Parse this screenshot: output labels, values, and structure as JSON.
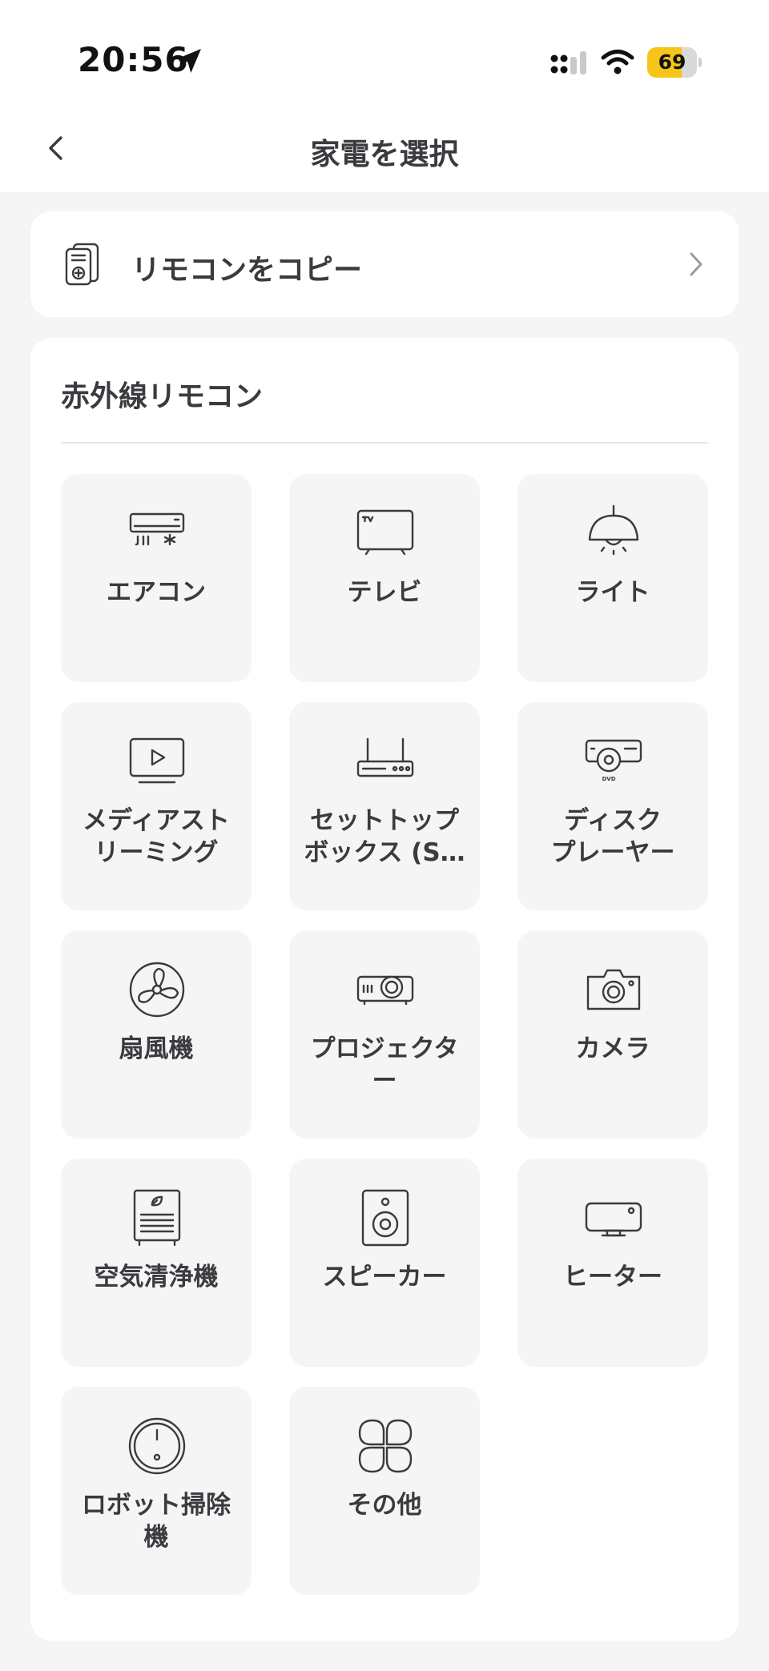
{
  "status_bar": {
    "time": "20:56",
    "battery": "69",
    "battery_level": 0.69
  },
  "nav": {
    "title": "家電を選択",
    "back_icon": "chevron-left-icon"
  },
  "copy_remote": {
    "label": "リモコンをコピー",
    "icon": "remote-copy-icon",
    "chevron_icon": "chevron-right-icon"
  },
  "ir_section": {
    "title": "赤外線リモコン",
    "devices": [
      {
        "label": "エアコン",
        "icon": "air-conditioner-icon"
      },
      {
        "label": "テレビ",
        "icon": "tv-icon"
      },
      {
        "label": "ライト",
        "icon": "light-icon"
      },
      {
        "label": "メディアスト\nリーミング",
        "icon": "media-streaming-icon"
      },
      {
        "label": "セットトップ\nボックス (S…",
        "icon": "set-top-box-icon"
      },
      {
        "label": "ディスク\nプレーヤー",
        "icon": "disc-player-icon"
      },
      {
        "label": "扇風機",
        "icon": "fan-icon"
      },
      {
        "label": "プロジェクタ\nー",
        "icon": "projector-icon"
      },
      {
        "label": "カメラ",
        "icon": "camera-icon"
      },
      {
        "label": "空気清浄機",
        "icon": "air-purifier-icon"
      },
      {
        "label": "スピーカー",
        "icon": "speaker-icon"
      },
      {
        "label": "ヒーター",
        "icon": "heater-icon"
      },
      {
        "label": "ロボット掃除\n機",
        "icon": "robot-vacuum-icon"
      },
      {
        "label": "その他",
        "icon": "other-icon"
      }
    ]
  }
}
